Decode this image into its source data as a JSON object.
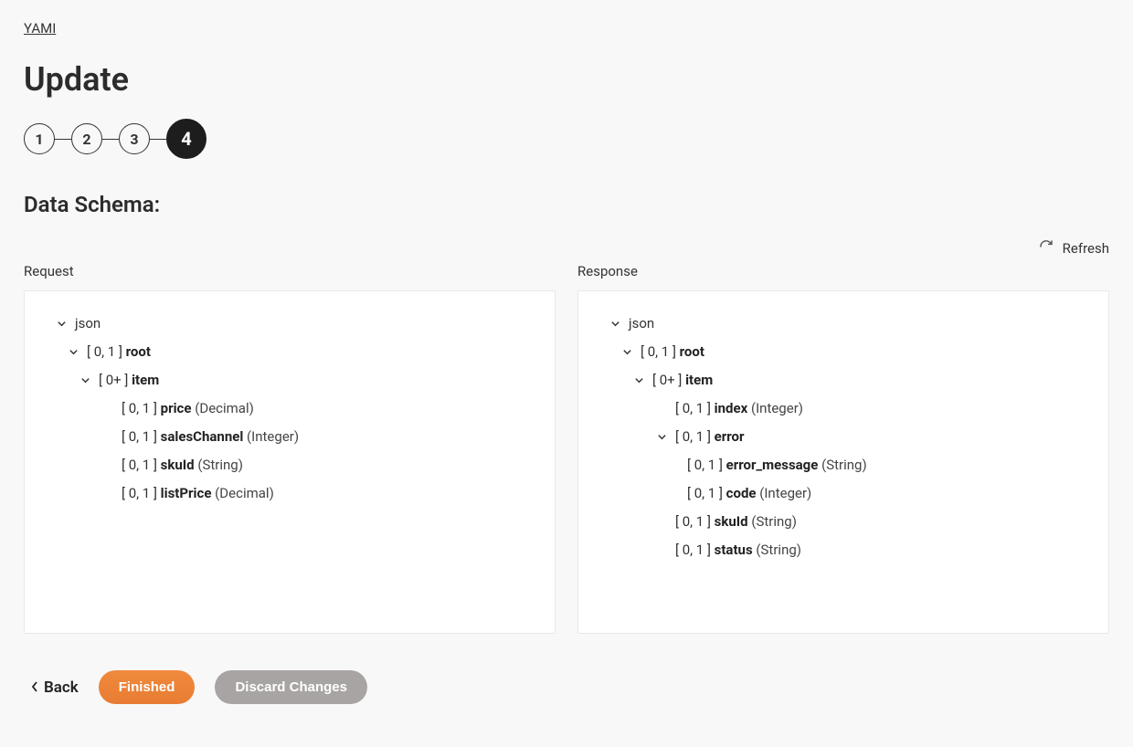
{
  "breadcrumb": {
    "root": "YAMI"
  },
  "page_title": "Update",
  "stepper": {
    "steps": [
      "1",
      "2",
      "3",
      "4"
    ],
    "active_index": 3
  },
  "section_title": "Data Schema:",
  "refresh_label": "Refresh",
  "columns": {
    "request_label": "Request",
    "response_label": "Response"
  },
  "request_tree": [
    {
      "depth": 0,
      "expandable": true,
      "cardinality": "",
      "name": "json",
      "type": ""
    },
    {
      "depth": 1,
      "expandable": true,
      "cardinality": "[ 0, 1 ]",
      "name": "root",
      "type": ""
    },
    {
      "depth": 2,
      "expandable": true,
      "cardinality": "[ 0+ ]",
      "name": "item",
      "type": ""
    },
    {
      "depth": 3,
      "expandable": false,
      "cardinality": "[ 0, 1 ]",
      "name": "price",
      "type": "(Decimal)"
    },
    {
      "depth": 3,
      "expandable": false,
      "cardinality": "[ 0, 1 ]",
      "name": "salesChannel",
      "type": "(Integer)"
    },
    {
      "depth": 3,
      "expandable": false,
      "cardinality": "[ 0, 1 ]",
      "name": "skuId",
      "type": "(String)"
    },
    {
      "depth": 3,
      "expandable": false,
      "cardinality": "[ 0, 1 ]",
      "name": "listPrice",
      "type": "(Decimal)"
    }
  ],
  "response_tree": [
    {
      "depth": 0,
      "expandable": true,
      "cardinality": "",
      "name": "json",
      "type": ""
    },
    {
      "depth": 1,
      "expandable": true,
      "cardinality": "[ 0, 1 ]",
      "name": "root",
      "type": ""
    },
    {
      "depth": 2,
      "expandable": true,
      "cardinality": "[ 0+ ]",
      "name": "item",
      "type": ""
    },
    {
      "depth": 3,
      "expandable": false,
      "cardinality": "[ 0, 1 ]",
      "name": "index",
      "type": "(Integer)"
    },
    {
      "depth": 3,
      "expandable": true,
      "cardinality": "[ 0, 1 ]",
      "name": "error",
      "type": ""
    },
    {
      "depth": 4,
      "expandable": false,
      "cardinality": "[ 0, 1 ]",
      "name": "error_message",
      "type": "(String)"
    },
    {
      "depth": 4,
      "expandable": false,
      "cardinality": "[ 0, 1 ]",
      "name": "code",
      "type": "(Integer)"
    },
    {
      "depth": 3,
      "expandable": false,
      "cardinality": "[ 0, 1 ]",
      "name": "skuId",
      "type": "(String)"
    },
    {
      "depth": 3,
      "expandable": false,
      "cardinality": "[ 0, 1 ]",
      "name": "status",
      "type": "(String)"
    }
  ],
  "footer": {
    "back_label": "Back",
    "primary_label": "Finished",
    "secondary_label": "Discard Changes"
  }
}
